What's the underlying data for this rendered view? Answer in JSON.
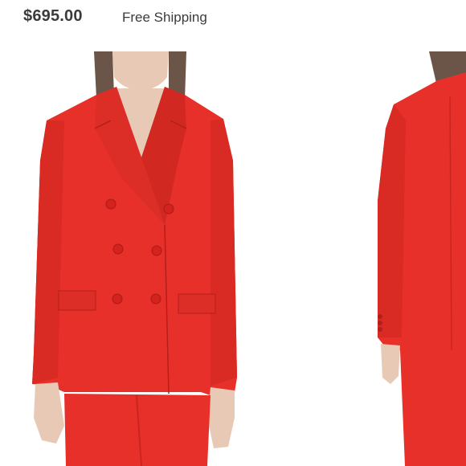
{
  "listing": {
    "price": "$695.00",
    "shipping": "Free Shipping"
  },
  "photo": {
    "subject": "red double-breasted blazer and trousers, front and back view",
    "colors": {
      "garment": "#e8302a",
      "garment_shadow": "#c92520",
      "skin": "#e8c9b6",
      "hair": "#6b5548",
      "background": "#ffffff"
    }
  }
}
